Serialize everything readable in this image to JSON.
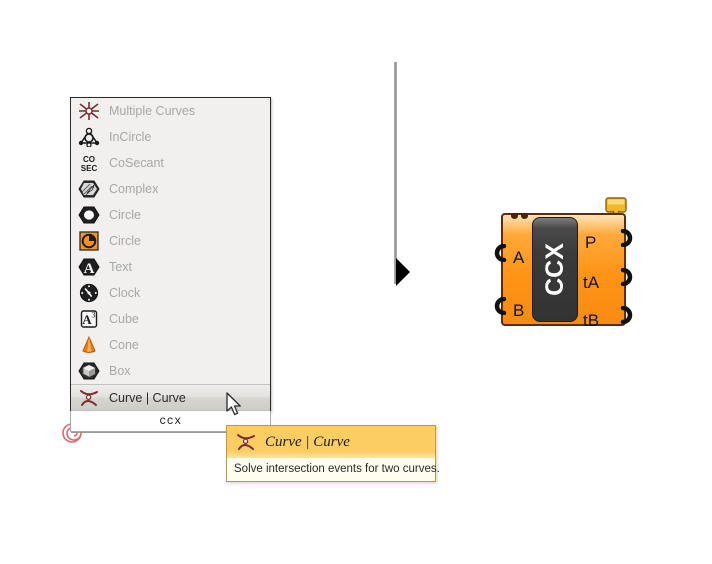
{
  "app": {
    "title": "Grasshopper Canvas",
    "canvas_bg": "#ffffff"
  },
  "menu": {
    "name": "component-palette-popup",
    "items": [
      {
        "label": "Multiple Curves",
        "icon": "multiple-curves-icon",
        "enabled": false
      },
      {
        "label": "InCircle",
        "icon": "incircle-icon",
        "enabled": false
      },
      {
        "label": "CoSecant",
        "icon": "cosecant-icon",
        "enabled": false
      },
      {
        "label": "Complex",
        "icon": "complex-icon",
        "enabled": false
      },
      {
        "label": "Circle",
        "icon": "circle-icon",
        "enabled": false
      },
      {
        "label": "Circle",
        "icon": "circle-pie-icon",
        "enabled": false
      },
      {
        "label": "Text",
        "icon": "text-icon",
        "enabled": false
      },
      {
        "label": "Clock",
        "icon": "clock-icon",
        "enabled": false
      },
      {
        "label": "Cube",
        "icon": "cube-icon",
        "enabled": false
      },
      {
        "label": "Cone",
        "icon": "cone-icon",
        "enabled": false
      },
      {
        "label": "Box",
        "icon": "box-icon",
        "enabled": false
      },
      {
        "label": "Curve | Curve",
        "icon": "curve-curve-icon",
        "enabled": true
      }
    ]
  },
  "search": {
    "value": "ccx",
    "placeholder": "ccx"
  },
  "tooltip": {
    "icon": "curve-curve-icon",
    "title": "Curve | Curve",
    "description": "Solve intersection events for two curves.",
    "header_color": "#fbcd63",
    "body_color": "#fffdf0",
    "border_color": "#c59a35"
  },
  "component": {
    "nickname": "CCX",
    "accent_color": "#ff9416",
    "border_color": "#5a2d12",
    "inputs": [
      {
        "label": "A"
      },
      {
        "label": "B"
      }
    ],
    "outputs": [
      {
        "label": "P"
      },
      {
        "label": "tA"
      },
      {
        "label": "tB"
      }
    ],
    "balloon_icon": "message-balloon-icon"
  },
  "canvas_marks": {
    "group_divider": "vertical-group-line",
    "group_arrow": "group-collapse-arrow",
    "spiral": "spiral-marker-icon",
    "cursor": "mouse-pointer-icon"
  }
}
